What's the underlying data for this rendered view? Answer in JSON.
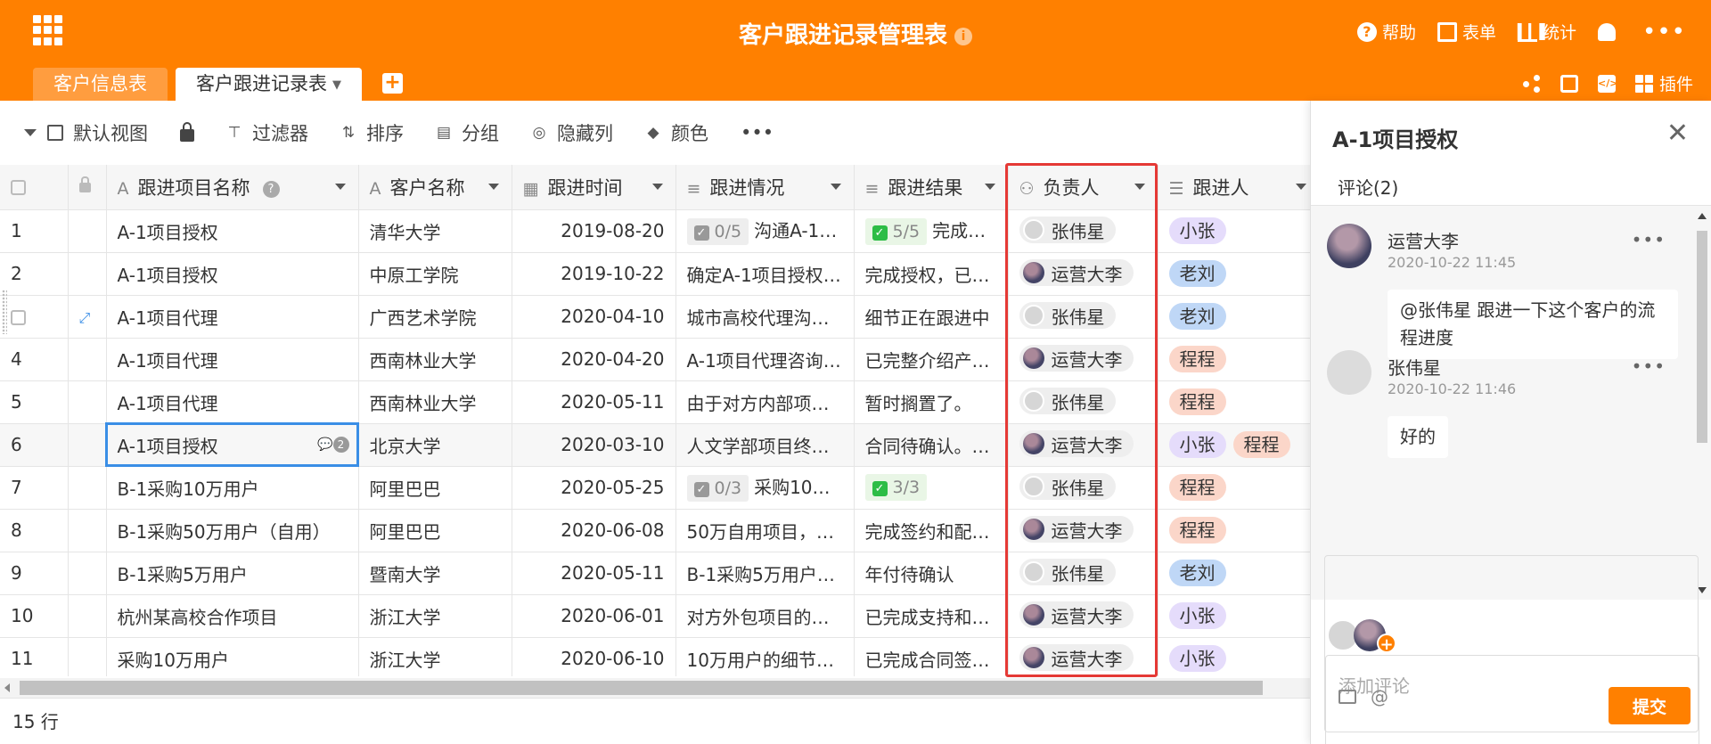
{
  "app": {
    "title": "客户跟进记录管理表",
    "info_icon": "info-icon",
    "actions": [
      {
        "label": "帮助",
        "icon": "help-icon"
      },
      {
        "label": "表单",
        "icon": "form-icon"
      },
      {
        "label": "统计",
        "icon": "chart-icon"
      }
    ],
    "more_label": "•••"
  },
  "tabs": {
    "items": [
      {
        "label": "客户信息表",
        "active": false
      },
      {
        "label": "客户跟进记录表",
        "active": true
      }
    ],
    "add_label": "+"
  },
  "right_tools": {
    "plugin_label": "插件"
  },
  "toolbar": {
    "view_label": "默认视图",
    "filter_label": "过滤器",
    "sort_label": "排序",
    "group_label": "分组",
    "hide_label": "隐藏列",
    "color_label": "颜色",
    "more_label": "•••"
  },
  "table": {
    "columns": [
      {
        "label": "跟进项目名称",
        "icon": "text-icon",
        "has_help": true
      },
      {
        "label": "客户名称",
        "icon": "text-icon"
      },
      {
        "label": "跟进时间",
        "icon": "calendar-icon"
      },
      {
        "label": "跟进情况",
        "icon": "longtext-icon"
      },
      {
        "label": "跟进结果",
        "icon": "longtext-icon"
      },
      {
        "label": "负责人",
        "icon": "people-icon"
      },
      {
        "label": "跟进人",
        "icon": "list-icon"
      }
    ],
    "rows": [
      {
        "num": "1",
        "project": "A-1项目授权",
        "customer": "清华大学",
        "date": "2019-08-20",
        "status": {
          "check": "0/5",
          "check_color": "grey",
          "text": "沟通A-1项..."
        },
        "result": {
          "check": "5/5",
          "check_color": "green",
          "text": "完成A-1..."
        },
        "owner": {
          "name": "张伟星",
          "avatar": "light"
        },
        "followers": [
          {
            "name": "小张",
            "color": "purple"
          }
        ]
      },
      {
        "num": "2",
        "project": "A-1项目授权",
        "customer": "中原工学院",
        "date": "2019-10-22",
        "status": {
          "text": "确定A-1项目授权合..."
        },
        "result": {
          "text": "完成授权，已签..."
        },
        "owner": {
          "name": "运营大李",
          "avatar": "dark"
        },
        "followers": [
          {
            "name": "老刘",
            "color": "blue"
          }
        ]
      },
      {
        "num": "",
        "project": "A-1项目代理",
        "customer": "广西艺术学院",
        "date": "2020-04-10",
        "status": {
          "text": "城市高校代理沟通..."
        },
        "result": {
          "text": "细节正在跟进中"
        },
        "owner": {
          "name": "张伟星",
          "avatar": "light"
        },
        "followers": [
          {
            "name": "老刘",
            "color": "blue"
          }
        ]
      },
      {
        "num": "4",
        "project": "A-1项目代理",
        "customer": "西南林业大学",
        "date": "2020-04-20",
        "status": {
          "text": "A-1项目代理咨询，..."
        },
        "result": {
          "text": "已完整介绍产品..."
        },
        "owner": {
          "name": "运营大李",
          "avatar": "dark"
        },
        "followers": [
          {
            "name": "程程",
            "color": "pink"
          }
        ]
      },
      {
        "num": "5",
        "project": "A-1项目代理",
        "customer": "西南林业大学",
        "date": "2020-05-11",
        "status": {
          "text": "由于对方内部项目..."
        },
        "result": {
          "text": "暂时搁置了。"
        },
        "owner": {
          "name": "张伟星",
          "avatar": "light"
        },
        "followers": [
          {
            "name": "程程",
            "color": "pink"
          }
        ]
      },
      {
        "num": "6",
        "project": "A-1项目授权",
        "customer": "北京大学",
        "date": "2020-03-10",
        "status": {
          "text": "人文学部项目终身..."
        },
        "result": {
          "text": "合同待确认。已..."
        },
        "owner": {
          "name": "运营大李",
          "avatar": "dark"
        },
        "followers": [
          {
            "name": "小张",
            "color": "purple"
          },
          {
            "name": "程程",
            "color": "pink"
          }
        ],
        "comments": "2"
      },
      {
        "num": "7",
        "project": "B-1采购10万用户",
        "customer": "阿里巴巴",
        "date": "2020-05-25",
        "status": {
          "check": "0/3",
          "check_color": "grey",
          "text": "采购10万用..."
        },
        "result": {
          "check": "3/3",
          "check_color": "green",
          "text": ""
        },
        "owner": {
          "name": "张伟星",
          "avatar": "light"
        },
        "followers": [
          {
            "name": "程程",
            "color": "pink"
          }
        ]
      },
      {
        "num": "8",
        "project": "B-1采购50万用户（自用）",
        "customer": "阿里巴巴",
        "date": "2020-06-08",
        "status": {
          "text": "50万自用项目，已..."
        },
        "result": {
          "text": "完成签约和配置..."
        },
        "owner": {
          "name": "运营大李",
          "avatar": "dark"
        },
        "followers": [
          {
            "name": "程程",
            "color": "pink"
          }
        ]
      },
      {
        "num": "9",
        "project": "B-1采购5万用户",
        "customer": "暨南大学",
        "date": "2020-05-11",
        "status": {
          "text": "B-1采购5万用户的..."
        },
        "result": {
          "text": "年付待确认"
        },
        "owner": {
          "name": "张伟星",
          "avatar": "light"
        },
        "followers": [
          {
            "name": "老刘",
            "color": "blue"
          }
        ]
      },
      {
        "num": "10",
        "project": "杭州某高校合作项目",
        "customer": "浙江大学",
        "date": "2020-06-01",
        "status": {
          "text": "对方外包项目的沟通..."
        },
        "result": {
          "text": "已完成支持和支..."
        },
        "owner": {
          "name": "运营大李",
          "avatar": "dark"
        },
        "followers": [
          {
            "name": "小张",
            "color": "purple"
          }
        ]
      },
      {
        "num": "11",
        "project": "采购10万用户",
        "customer": "浙江大学",
        "date": "2020-06-10",
        "status": {
          "text": "10万用户的细节沟..."
        },
        "result": {
          "text": "已完成合同签约..."
        },
        "owner": {
          "name": "运营大李",
          "avatar": "dark"
        },
        "followers": [
          {
            "name": "小张",
            "color": "purple"
          }
        ]
      }
    ]
  },
  "footer": {
    "row_count": "15 行"
  },
  "panel": {
    "title": "A-1项目授权",
    "close_label": "✕",
    "tab_label": "评论(2)",
    "comments": [
      {
        "author": "运营大李",
        "time": "2020-10-22 11:45",
        "text": "@张伟星 跟进一下这个客户的流程进度",
        "avatar": "dark"
      },
      {
        "author": "张伟星",
        "time": "2020-10-22 11:46",
        "text": "好的",
        "avatar": "light"
      }
    ],
    "input_placeholder": "添加评论",
    "mention_label": "@",
    "submit_label": "提交"
  },
  "colors": {
    "brand": "#ff8000",
    "highlight": "#e53935",
    "selection": "#3a8ee6"
  }
}
